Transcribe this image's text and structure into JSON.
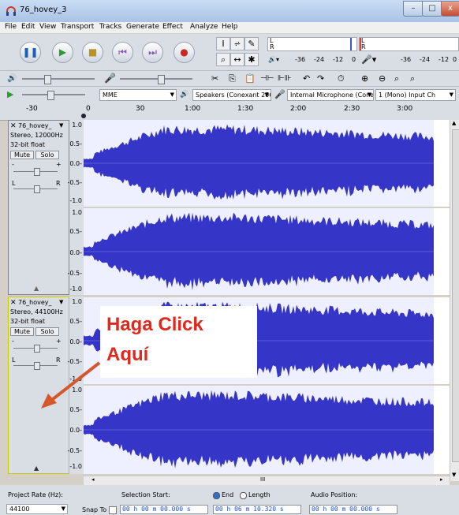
{
  "window": {
    "title": "76_hovey_3",
    "minimize": "–",
    "maximize": "□",
    "close": "x"
  },
  "menu": [
    "File",
    "Edit",
    "View",
    "Transport",
    "Tracks",
    "Generate",
    "Effect",
    "Analyze",
    "Help"
  ],
  "transport_icons": [
    "pause-icon",
    "play-icon",
    "stop-icon",
    "skip-start-icon",
    "skip-end-icon",
    "record-icon"
  ],
  "meters": {
    "play_ticks": [
      "-36",
      "-24",
      "-12",
      "0"
    ],
    "rec_ticks": [
      "-36",
      "-24",
      "-12",
      "0"
    ],
    "L": "L",
    "R": "R"
  },
  "devices": {
    "host": "MME",
    "output": "Speakers (Conexant 20672 Sm",
    "input": "Internal Microphone (Conexar",
    "channels": "1 (Mono) Input Ch"
  },
  "ruler": [
    "-30",
    "0",
    "30",
    "1:00",
    "1:30",
    "2:00",
    "2:30",
    "3:00"
  ],
  "tracks": [
    {
      "name": "76_hovey_",
      "info1": "Stereo, 12000Hz",
      "info2": "32-bit float",
      "mute": "Mute",
      "solo": "Solo",
      "minus": "-",
      "plus": "+",
      "L": "L",
      "R": "R",
      "scale": [
        "1.0",
        "0.5-",
        "0.0-",
        "-0.5-",
        "-1.0"
      ],
      "scale2": [
        "1.0",
        "0.5-",
        "0.0-",
        "-0.5-",
        "-1.0"
      ]
    },
    {
      "name": "76_hovey_",
      "info1": "Stereo, 44100Hz",
      "info2": "32-bit float",
      "mute": "Mute",
      "solo": "Solo",
      "minus": "-",
      "plus": "+",
      "L": "L",
      "R": "R",
      "scale": [
        "1.0",
        "0.5-",
        "0.0-",
        "-0.5-",
        "-1.0"
      ],
      "scale2": [
        "1.0",
        "0.5-",
        "0.0-",
        "-0.5-",
        "-1.0"
      ]
    }
  ],
  "overlay": {
    "line1": "Haga Click",
    "line2": "Aquí"
  },
  "scroll_mark": "III",
  "status": {
    "rate_label": "Project Rate (Hz):",
    "rate_value": "44100",
    "snap_label": "Snap To",
    "sel_start_label": "Selection Start:",
    "end_label": "End",
    "length_label": "Length",
    "audio_pos_label": "Audio Position:",
    "sel_start": "00 h 00 m 00.000 s",
    "sel_end": "00 h 06 m 10.320 s",
    "audio_pos": "00 h 00 m 00.000 s"
  },
  "colors": {
    "wave": "#3535c8",
    "wave_bg": "#ffffff",
    "selected_border": "#c9c900",
    "overlay_text": "#e2271c",
    "arrow": "#d6572d"
  }
}
